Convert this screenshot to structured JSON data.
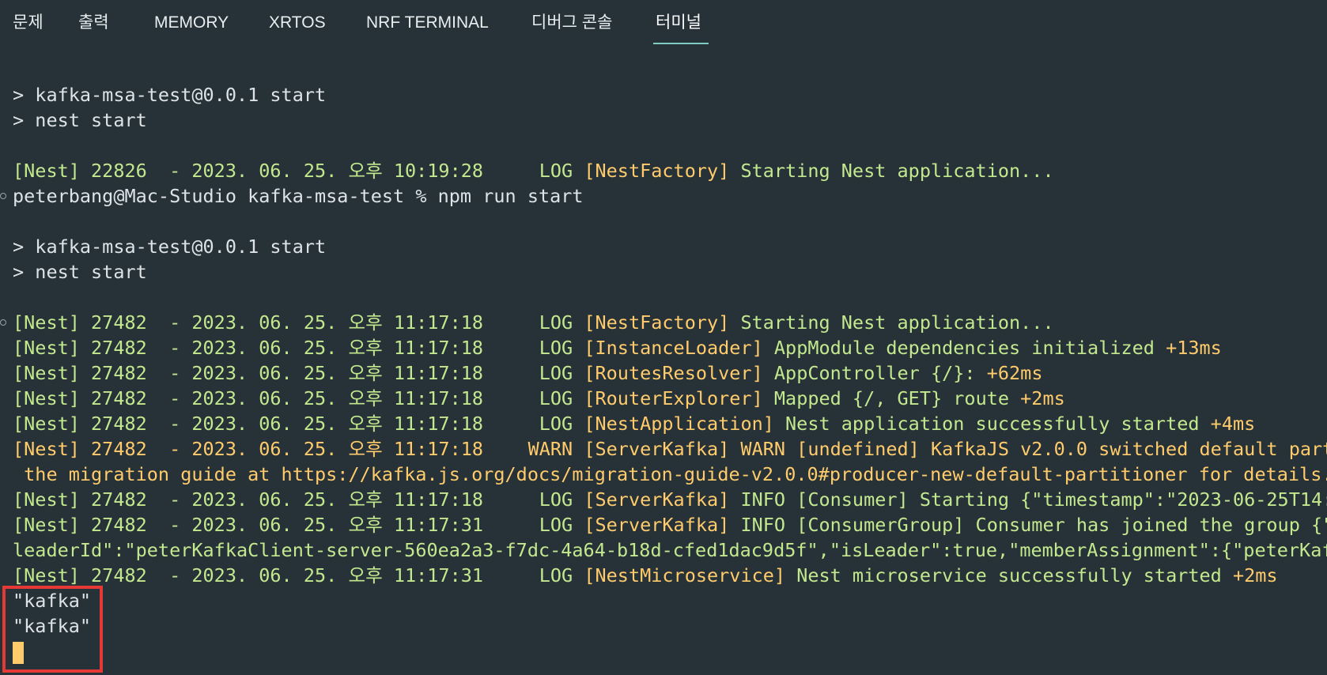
{
  "tabs": [
    {
      "label": "문제"
    },
    {
      "label": "출력"
    },
    {
      "label": "MEMORY"
    },
    {
      "label": "XRTOS"
    },
    {
      "label": "NRF TERMINAL"
    },
    {
      "label": "디버그 콘솔"
    },
    {
      "label": "터미널",
      "active": true
    }
  ],
  "terminal": {
    "lines": [
      {
        "text": "> kafka-msa-test@0.0.1 start"
      },
      {
        "text": "> nest start"
      },
      {
        "text": ""
      },
      {
        "nest": "[Nest] 22826  - 2023. 06. 25. 오후 10:19:28     ",
        "level": "LOG",
        "ctx": " [NestFactory]",
        "msg": " Starting Nest application..."
      },
      {
        "text": "peterbang@Mac-Studio kafka-msa-test % npm run start"
      },
      {
        "text": ""
      },
      {
        "text": "> kafka-msa-test@0.0.1 start"
      },
      {
        "text": "> nest start"
      },
      {
        "text": ""
      },
      {
        "nest": "[Nest] 27482  - 2023. 06. 25. 오후 11:17:18     ",
        "level": "LOG",
        "ctx": " [NestFactory]",
        "msg": " Starting Nest application..."
      },
      {
        "nest": "[Nest] 27482  - 2023. 06. 25. 오후 11:17:18     ",
        "level": "LOG",
        "ctx": " [InstanceLoader]",
        "msg": " AppModule dependencies initialized",
        "suffix": " +13ms"
      },
      {
        "nest": "[Nest] 27482  - 2023. 06. 25. 오후 11:17:18     ",
        "level": "LOG",
        "ctx": " [RoutesResolver]",
        "msg": " AppController {/}:",
        "suffix": " +62ms"
      },
      {
        "nest": "[Nest] 27482  - 2023. 06. 25. 오후 11:17:18     ",
        "level": "LOG",
        "ctx": " [RouterExplorer]",
        "msg": " Mapped {/, GET} route",
        "suffix": " +2ms"
      },
      {
        "nest": "[Nest] 27482  - 2023. 06. 25. 오후 11:17:18     ",
        "level": "LOG",
        "ctx": " [NestApplication]",
        "msg": " Nest application successfully started",
        "suffix": " +4ms"
      },
      {
        "warnline": "[Nest] 27482  - 2023. 06. 25. 오후 11:17:18    WARN [ServerKafka] WARN [undefined] KafkaJS v2.0.0 switched default part"
      },
      {
        "warnline": " the migration guide at https://kafka.js.org/docs/migration-guide-v2.0.0#producer-new-default-partitioner for details."
      },
      {
        "nest": "[Nest] 27482  - 2023. 06. 25. 오후 11:17:18     ",
        "level": "LOG",
        "ctx": " [ServerKafka]",
        "msg": " INFO [Consumer] Starting {\"timestamp\":\"2023-06-25T14:"
      },
      {
        "nest": "[Nest] 27482  - 2023. 06. 25. 오후 11:17:31     ",
        "level": "LOG",
        "ctx": " [ServerKafka]",
        "msg": " INFO [ConsumerGroup] Consumer has joined the group {\""
      },
      {
        "green": "leaderId\":\"peterKafkaClient-server-560ea2a3-f7dc-4a64-b18d-cfed1dac9d5f\",\"isLeader\":true,\"memberAssignment\":{\"peterKafk"
      },
      {
        "nest": "[Nest] 27482  - 2023. 06. 25. 오후 11:17:31     ",
        "level": "LOG",
        "ctx": " [NestMicroservice]",
        "msg": " Nest microservice successfully started",
        "suffix": " +2ms"
      },
      {
        "text": "\"kafka\""
      },
      {
        "text": "\"kafka\""
      }
    ]
  }
}
